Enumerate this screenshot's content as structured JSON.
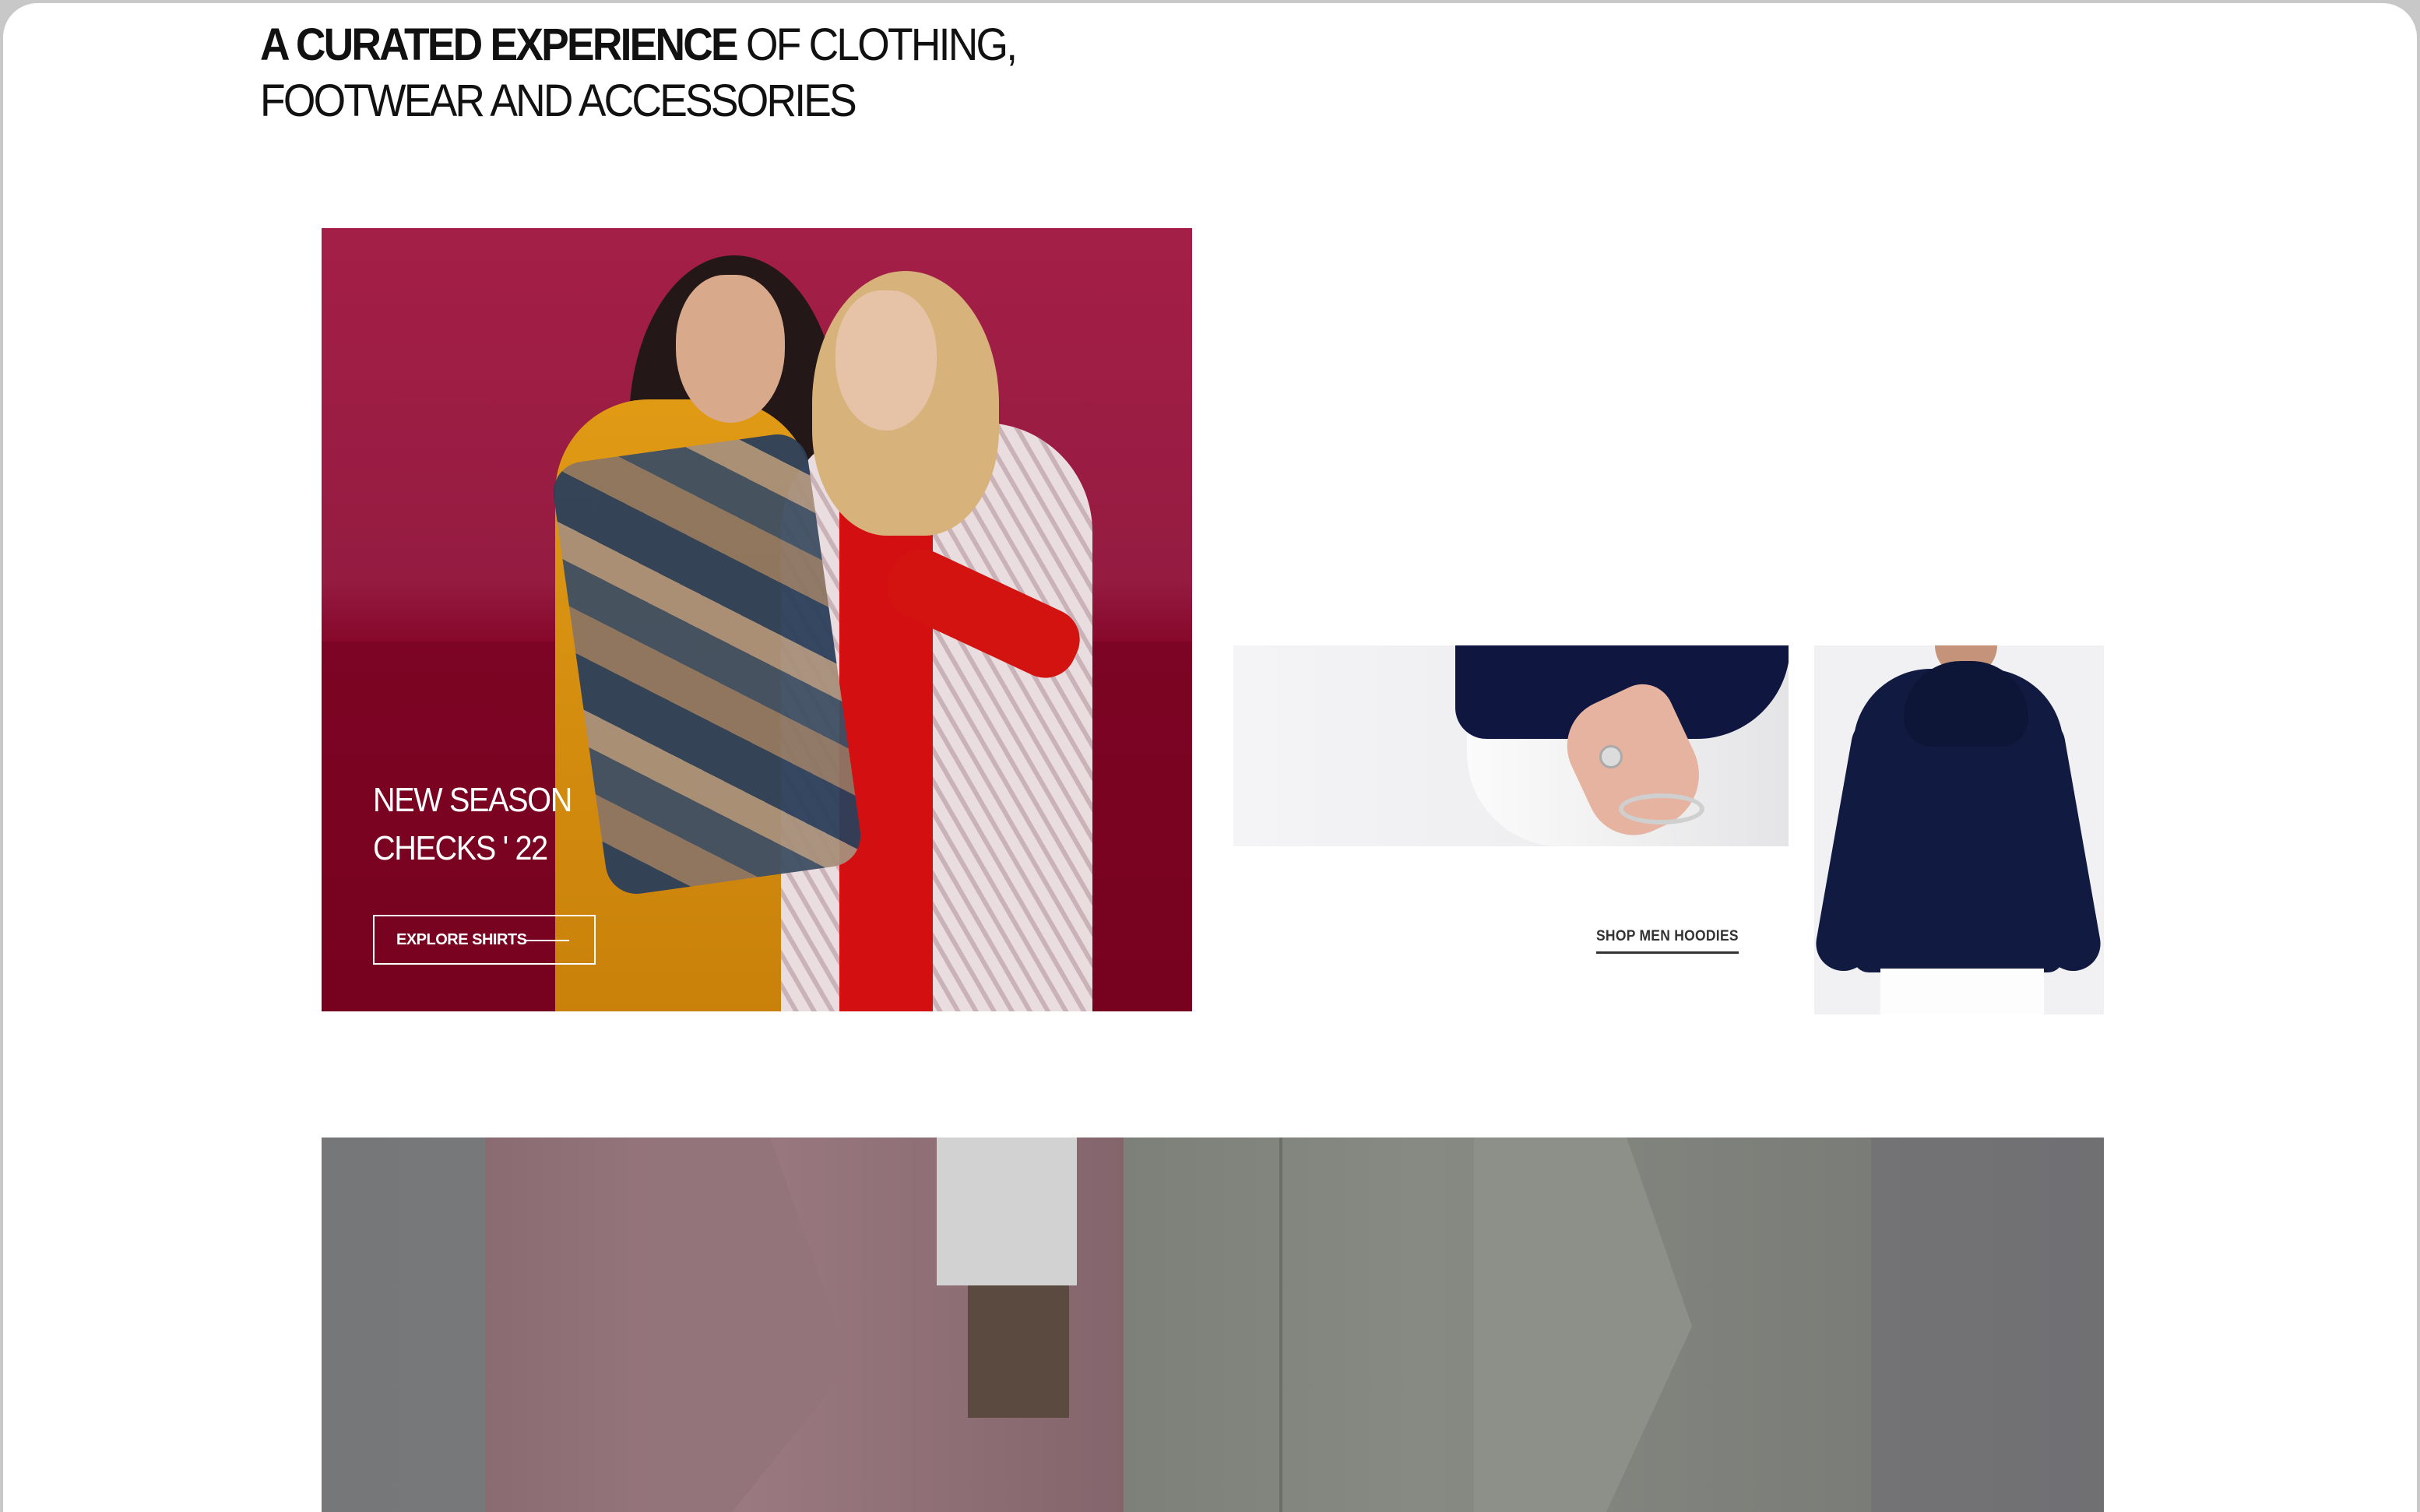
{
  "headline": {
    "bold": "A CURATED EXPERIENCE",
    "rest_line1": " OF CLOTHING,",
    "line2": "FOOTWEAR AND ACCESSORIES"
  },
  "hero": {
    "title": "NEW SEASON\nCHECKS ' 22",
    "button_label": "EXPLORE SHIRTS"
  },
  "promo": {
    "link_label": "SHOP MEN HOODIES"
  },
  "colors": {
    "hero_bg": "#a41f48",
    "hoodie_navy": "#111a40",
    "banner_gray": "#767779"
  }
}
